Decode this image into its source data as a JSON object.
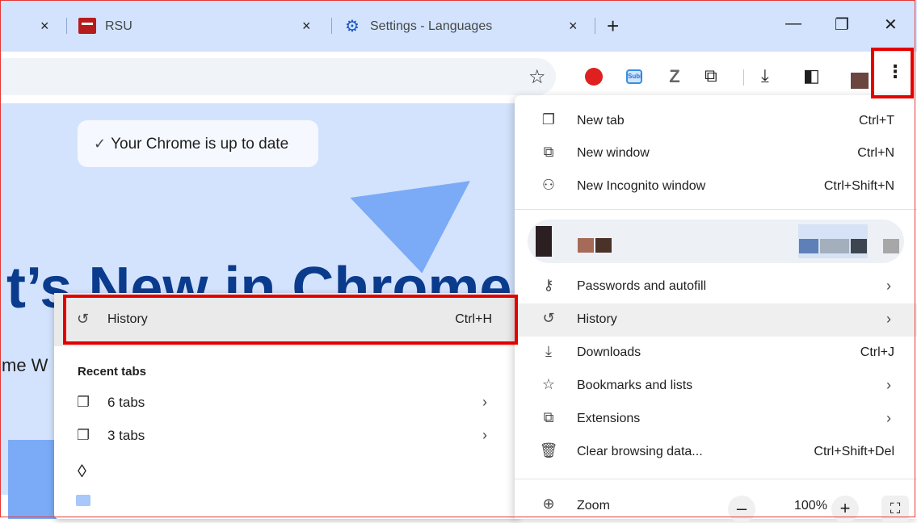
{
  "tabs": [
    {
      "title": "",
      "close": "×"
    },
    {
      "title": "RSU",
      "close": "×"
    },
    {
      "title": "Settings - Languages",
      "close": "×"
    }
  ],
  "new_tab_symbol": "+",
  "window": {
    "minimize": "—",
    "restore": "❐",
    "close": "✕"
  },
  "toolbar": {
    "subi_label": "Subi",
    "z_label": "Z"
  },
  "page": {
    "toast": "Your Chrome is up to date",
    "big_title": "t’s New in Chrome",
    "subtitle": "me W"
  },
  "submenu": {
    "history_label": "History",
    "history_shortcut": "Ctrl+H",
    "recent_heading": "Recent tabs",
    "recent_items": [
      {
        "label": "6 tabs"
      },
      {
        "label": "3 tabs"
      }
    ]
  },
  "menu": {
    "items_top": [
      {
        "label": "New tab",
        "shortcut": "Ctrl+T",
        "icon": "tab-icon"
      },
      {
        "label": "New window",
        "shortcut": "Ctrl+N",
        "icon": "window-icon"
      },
      {
        "label": "New Incognito window",
        "shortcut": "Ctrl+Shift+N",
        "icon": "incognito-icon"
      }
    ],
    "items_mid": [
      {
        "label": "Passwords and autofill",
        "icon": "key-icon"
      },
      {
        "label": "History",
        "icon": "history-icon"
      },
      {
        "label": "Downloads",
        "shortcut": "Ctrl+J",
        "icon": "download-icon"
      },
      {
        "label": "Bookmarks and lists",
        "icon": "star-icon"
      },
      {
        "label": "Extensions",
        "icon": "puzzle-icon"
      },
      {
        "label": "Clear browsing data...",
        "shortcut": "Ctrl+Shift+Del",
        "icon": "trash-icon"
      }
    ],
    "zoom": {
      "label": "Zoom",
      "value": "100%",
      "minus": "–",
      "plus": "+"
    }
  },
  "colors": {
    "accent": "#d3e3fd",
    "highlight": "#e50000",
    "title": "#0b3b8c"
  }
}
